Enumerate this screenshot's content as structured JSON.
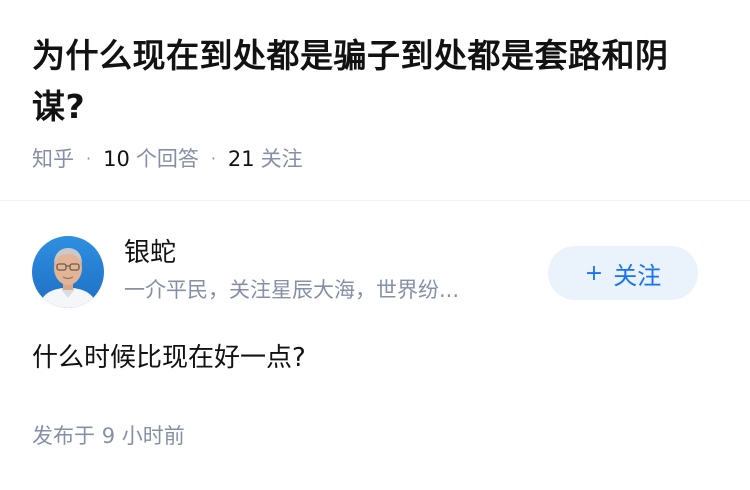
{
  "question": {
    "title": "为什么现在到处都是骗子到处都是套路和阴谋?",
    "source": "知乎",
    "separator": "·",
    "answers_count": "10",
    "answers_label": "个回答",
    "followers_count": "21",
    "followers_label": "关注"
  },
  "answer": {
    "author_name": "银蛇",
    "author_bio": "一介平民，关注星辰大海，世界纷...",
    "avatar_icon": "person-avatar-icon",
    "follow_plus": "+",
    "follow_label": "关注",
    "content": "什么时候比现在好一点?",
    "publish_prefix": "发布于",
    "publish_time": "9 小时前"
  },
  "colors": {
    "accent": "#1772f6",
    "follow_bg": "#eaf2fc",
    "meta": "#8590a6",
    "text": "#121212"
  }
}
